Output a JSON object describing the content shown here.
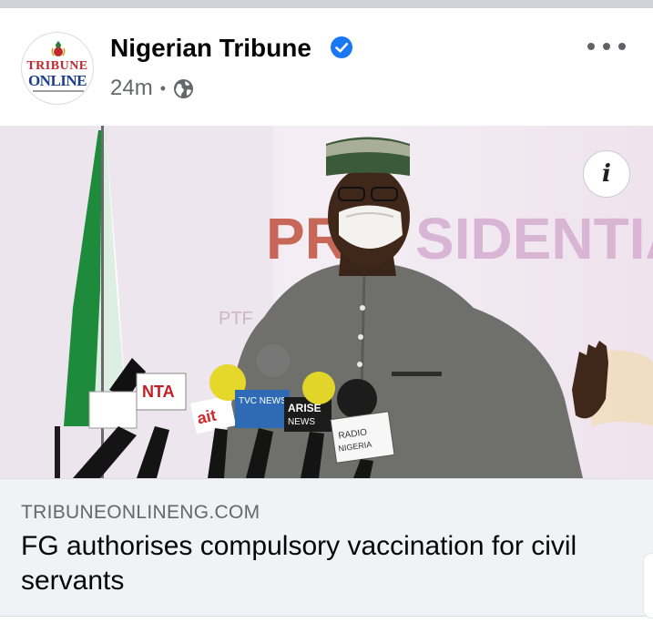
{
  "post": {
    "page_name": "Nigerian Tribune",
    "time_ago": "24m",
    "separator": "•",
    "privacy_icon": "globe-icon",
    "verified_icon": "verified-badge-icon",
    "more_icon": "more-options-icon",
    "avatar_logo": {
      "line1": "TRIBUNE",
      "line2": "ONLINE"
    }
  },
  "photo": {
    "info_label": "i",
    "info_icon": "info-icon",
    "backdrop_text": "PRESIDENTIAL",
    "mic_labels": [
      "NTA",
      "ait",
      "TVC NEWS",
      "ARISE NEWS",
      "RADIO NIGERIA"
    ]
  },
  "link": {
    "domain": "TRIBUNEONLINENG.COM",
    "headline": "FG authorises compulsory vaccination for civil servants"
  },
  "colors": {
    "verified_blue": "#1877f2",
    "meta_gray": "#65676b",
    "preview_bg": "#f0f2f5"
  }
}
